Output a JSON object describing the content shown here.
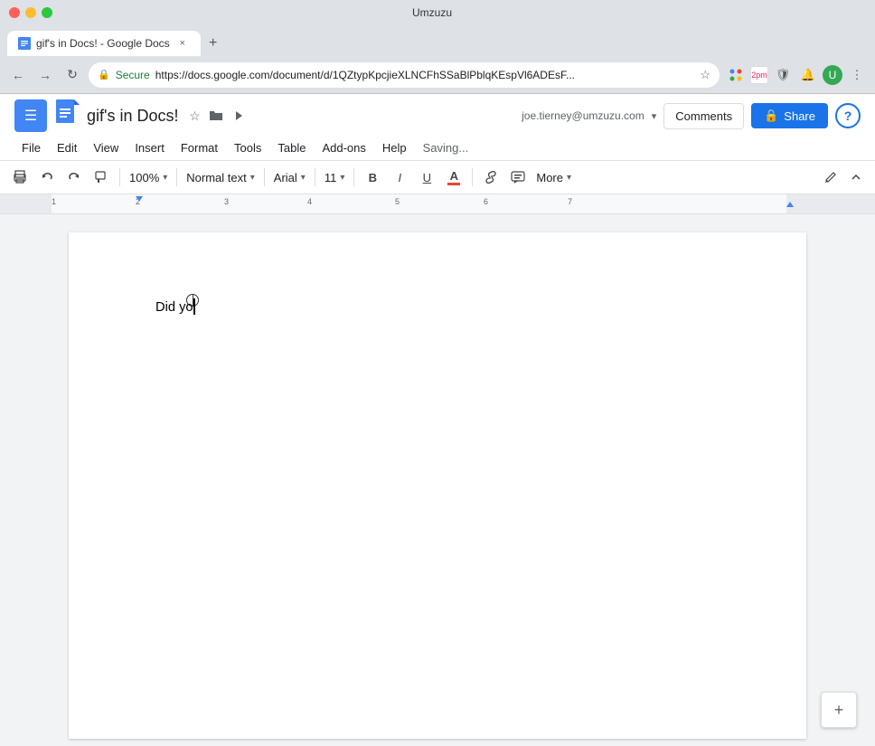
{
  "titlebar": {
    "title": "Umzuzu"
  },
  "browser": {
    "back_label": "←",
    "forward_label": "→",
    "refresh_label": "↻",
    "secure_text": "Secure",
    "url": "https://docs.google.com/document/d/1QZtypKpcjieXLNCFhSSaBlPblqKEspVl6ADEsF...",
    "star_icon": "★",
    "extensions": [
      "2pm"
    ],
    "more_label": "⋮"
  },
  "tab": {
    "title": "gif's in Docs! - Google Docs",
    "close_label": "×"
  },
  "docs": {
    "menu_icon_label": "☰",
    "title": "gif's in Docs!",
    "star_icon": "☆",
    "folder_icon": "📁",
    "move_icon": "▶",
    "user_email": "joe.tierney@umzuzu.com",
    "user_dropdown": "▾",
    "comments_label": "Comments",
    "share_label": "Share",
    "share_lock": "🔒",
    "help_label": "?",
    "saving_text": "Saving...",
    "menu_items": [
      "File",
      "Edit",
      "View",
      "Insert",
      "Format",
      "Tools",
      "Table",
      "Add-ons",
      "Help"
    ],
    "toolbar": {
      "print_icon": "🖨",
      "undo_icon": "↩",
      "redo_icon": "↪",
      "paint_icon": "🖌",
      "zoom_value": "100%",
      "zoom_chevron": "▾",
      "style_value": "Normal text",
      "style_chevron": "▾",
      "font_value": "Arial",
      "font_chevron": "▾",
      "size_value": "11",
      "size_chevron": "▾",
      "bold_label": "B",
      "italic_label": "I",
      "underline_label": "U",
      "text_color_label": "A",
      "link_icon": "🔗",
      "comment_icon": "💬",
      "more_label": "More",
      "more_chevron": "▾",
      "pencil_icon": "✏",
      "collapse_icon": "⌃"
    },
    "document": {
      "text": "Did yo",
      "cursor_visible": true
    }
  },
  "fab": {
    "icon": "+"
  }
}
